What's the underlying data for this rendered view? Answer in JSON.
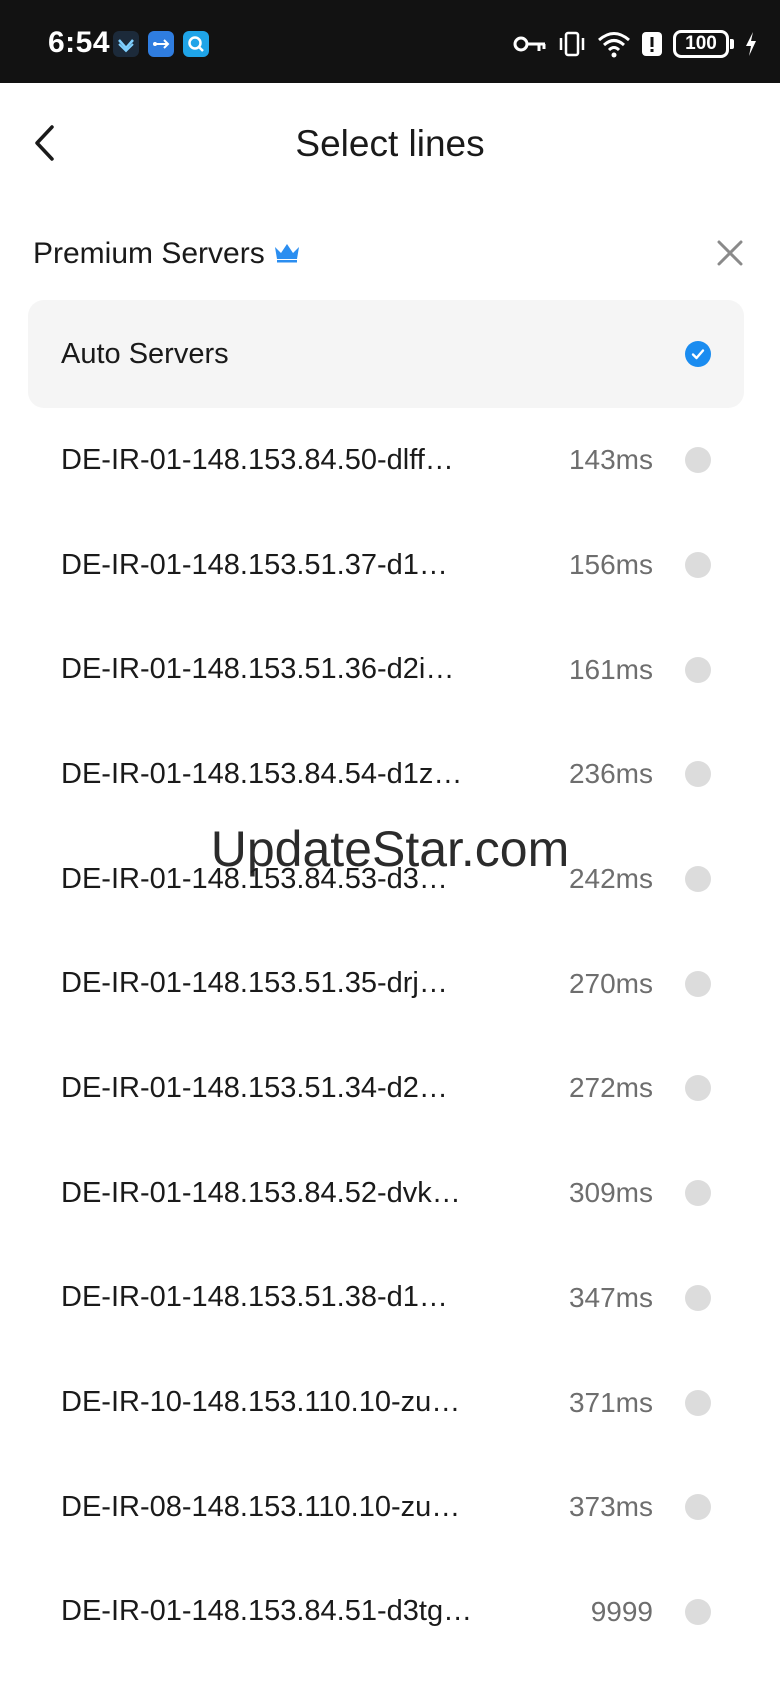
{
  "status_bar": {
    "time": "6:54",
    "battery": "100"
  },
  "header": {
    "title": "Select lines"
  },
  "section": {
    "title": "Premium Servers"
  },
  "colors": {
    "accent": "#1a8cf0",
    "crown": "#2b8ef0",
    "radio_off": "#dcdcdc"
  },
  "servers": [
    {
      "name": "Auto Servers",
      "ping": "",
      "selected": true
    },
    {
      "name": "DE-IR-01-148.153.84.50-dlff…",
      "ping": "143ms",
      "selected": false
    },
    {
      "name": "DE-IR-01-148.153.51.37-d1…",
      "ping": "156ms",
      "selected": false
    },
    {
      "name": "DE-IR-01-148.153.51.36-d2i…",
      "ping": "161ms",
      "selected": false
    },
    {
      "name": "DE-IR-01-148.153.84.54-d1z…",
      "ping": "236ms",
      "selected": false
    },
    {
      "name": "DE-IR-01-148.153.84.53-d3…",
      "ping": "242ms",
      "selected": false
    },
    {
      "name": "DE-IR-01-148.153.51.35-drj…",
      "ping": "270ms",
      "selected": false
    },
    {
      "name": "DE-IR-01-148.153.51.34-d2…",
      "ping": "272ms",
      "selected": false
    },
    {
      "name": "DE-IR-01-148.153.84.52-dvk…",
      "ping": "309ms",
      "selected": false
    },
    {
      "name": "DE-IR-01-148.153.51.38-d1…",
      "ping": "347ms",
      "selected": false
    },
    {
      "name": "DE-IR-10-148.153.110.10-zu…",
      "ping": "371ms",
      "selected": false
    },
    {
      "name": "DE-IR-08-148.153.110.10-zu…",
      "ping": "373ms",
      "selected": false
    },
    {
      "name": "DE-IR-01-148.153.84.51-d3tg…",
      "ping": "9999",
      "selected": false
    }
  ],
  "watermark": "UpdateStar.com"
}
